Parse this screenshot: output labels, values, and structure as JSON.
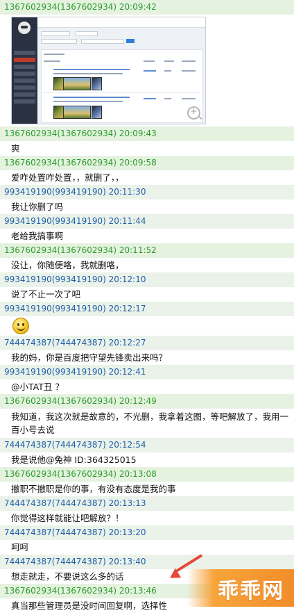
{
  "chat": {
    "messages": [
      {
        "id": "m1",
        "sender": "1367602934(1367602934) 20:09:42",
        "role": "admin",
        "kind": "image",
        "image_name": "management-panel-screenshot"
      },
      {
        "id": "m2",
        "sender": "1367602934(1367602934) 20:09:43",
        "role": "admin",
        "kind": "text",
        "text": "爽"
      },
      {
        "id": "m3",
        "sender": "1367602934(1367602934) 20:09:58",
        "role": "admin",
        "kind": "text",
        "text": "爱咋处置咋处置，，就删了，，"
      },
      {
        "id": "m4",
        "sender": "993419190(993419190) 20:11:30",
        "role": "member",
        "kind": "text",
        "text": "我让你删了吗"
      },
      {
        "id": "m5",
        "sender": "993419190(993419190) 20:11:44",
        "role": "member",
        "kind": "text",
        "text": "老给我搞事啊"
      },
      {
        "id": "m6",
        "sender": "1367602934(1367602934) 20:11:52",
        "role": "admin",
        "kind": "text",
        "text": "没让，你随便咯，我就删咯，"
      },
      {
        "id": "m7",
        "sender": "993419190(993419190) 20:12:10",
        "role": "member",
        "kind": "text",
        "text": "说了不止一次了吧"
      },
      {
        "id": "m8",
        "sender": "993419190(993419190) 20:12:17",
        "role": "member",
        "kind": "emoticon",
        "icon": "smiley-emoticon-icon"
      },
      {
        "id": "m9",
        "sender": "744474387(744474387) 20:12:27",
        "role": "member",
        "kind": "text",
        "text": "我的妈，你是百度把守望先锋卖出来吗？"
      },
      {
        "id": "m10",
        "sender": "993419190(993419190) 20:12:41",
        "role": "member",
        "kind": "text",
        "text": "@小TAT丑 ？"
      },
      {
        "id": "m11",
        "sender": "1367602934(1367602934) 20:12:49",
        "role": "admin",
        "kind": "text2",
        "text": "我知道，我这次就是故意的，不光删，我拿着这图，等吧解放了，我用一百小号去说"
      },
      {
        "id": "m12",
        "sender": "744474387(744474387) 20:12:54",
        "role": "member",
        "kind": "text",
        "text": "我是说他@兔神 ID:364325015"
      },
      {
        "id": "m13",
        "sender": "1367602934(1367602934) 20:13:08",
        "role": "admin",
        "kind": "text",
        "text": "撤职不撤职是你的事，有没有态度是我的事"
      },
      {
        "id": "m14",
        "sender": "744474387(744474387) 20:13:13",
        "role": "member",
        "kind": "text",
        "text": "你觉得这样就能让吧解放？！"
      },
      {
        "id": "m15",
        "sender": "744474387(744474387) 20:13:20",
        "role": "member",
        "kind": "text",
        "text": "呵呵"
      },
      {
        "id": "m16",
        "sender": "744474387(744474387) 20:13:40",
        "role": "member",
        "kind": "text",
        "text": "想走就走，不要说这么多的话"
      },
      {
        "id": "m17",
        "sender": "1367602934(1367602934) 20:13:46",
        "role": "admin",
        "kind": "text",
        "text": "真当那些管理员是没时间回复啊，选择性"
      }
    ]
  },
  "watermark": {
    "text": "乖乖网",
    "color": "#f28d2a"
  },
  "colors": {
    "admin": "#2a9d2a",
    "member": "#1f5fa8",
    "header_bg": "#e5f2e0"
  }
}
